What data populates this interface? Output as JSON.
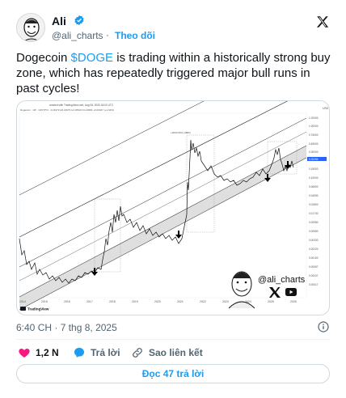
{
  "author": {
    "name": "Ali",
    "handle": "@ali_charts",
    "separator": "·",
    "follow_label": "Theo dõi"
  },
  "tweet": {
    "text_before": "Dogecoin ",
    "cashtag": "$DOGE",
    "text_after": " is trading within a historically strong buy zone, which has repeatedly triggered major bull runs in past cycles!"
  },
  "chart": {
    "header_line1": "created with TradingView.com, Aug 08, 2025 18:00 UTC",
    "header_line2": "Dogecoin · 1W · CRYPTO · 0.21973 H0.21973 L0.19543 C0.20284 +0.00327 (+1.64%)",
    "currency": "USD",
    "price_labels": [
      "1.20000",
      "1.00000",
      "0.75000",
      "0.45000",
      "0.30000",
      "0.20284",
      "0.15000",
      "0.10000",
      "0.06500",
      "0.04090",
      "0.02800",
      "0.01730",
      "0.00980",
      "0.00550",
      "0.00330",
      "0.00220",
      "0.00100",
      "0.00067",
      "0.00037",
      "0.00017"
    ],
    "current_price": "0.20284",
    "year_labels": [
      "2014",
      "2015",
      "2016",
      "2017",
      "2018",
      "2019",
      "2020",
      "2021",
      "2022",
      "2023",
      "2024",
      "2025",
      "2026"
    ],
    "brand": "TradingView",
    "watermark_handle": "@ali_charts",
    "top_label": "+3000.00% (4880)",
    "colors": {
      "line": "#000000",
      "band": "#d9d9d9",
      "price_tag": "#2962ff"
    }
  },
  "meta": {
    "time": "6:40 CH",
    "separator": "·",
    "date": "7 thg 8, 2025"
  },
  "actions": {
    "likes": "1,2 N",
    "reply_label": "Trả lời",
    "copy_link_label": "Sao liên kết",
    "read_replies_label": "Đọc 47 trả lời"
  },
  "colors": {
    "accent": "#1d9bf0",
    "like": "#f91880",
    "muted": "#536471"
  }
}
